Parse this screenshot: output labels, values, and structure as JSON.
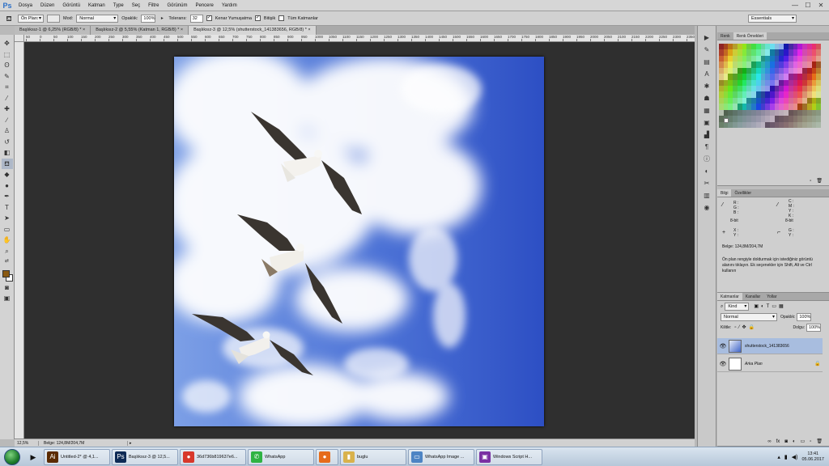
{
  "app": {
    "logo": "Ps"
  },
  "menubar": [
    "Dosya",
    "Düzen",
    "Görüntü",
    "Katman",
    "Type",
    "Seç",
    "Filtre",
    "Görünüm",
    "Pencere",
    "Yardım"
  ],
  "window_controls": {
    "minimize": "—",
    "maximize": "☐",
    "close": "✕"
  },
  "options": {
    "tool_preset": "Ön Plan:",
    "mode_label": "Mod:",
    "mode_value": "Normal",
    "opacity_label": "Opaklık:",
    "opacity_value": "100%",
    "tolerance_label": "Tolerans:",
    "tolerance_value": "32",
    "antialias_label": "Kenar Yumuşatma",
    "contiguous_label": "Bitişik",
    "all_layers_label": "Tüm Katmanlar",
    "workspace": "Essentials"
  },
  "doc_tabs": [
    {
      "label": "Başlıksız-1 @ 6,25% (RGB/8) *",
      "active": false
    },
    {
      "label": "Başlıksız-2 @ 5,55% (Katman 1, RGB/8) *",
      "active": false
    },
    {
      "label": "Başlıksız-3 @ 12,5% (shutterstock_141383656, RGB/8) *",
      "active": true
    }
  ],
  "ruler_labels": [
    "50",
    "0",
    "50",
    "100",
    "150",
    "200",
    "250",
    "300",
    "350",
    "400",
    "450",
    "500",
    "550",
    "600",
    "650",
    "700",
    "750",
    "800",
    "850",
    "900",
    "950",
    "1000",
    "1050",
    "1100",
    "1150",
    "1200",
    "1250",
    "1300",
    "1350",
    "1400",
    "1450",
    "1500",
    "1550",
    "1600",
    "1650",
    "1700",
    "1750",
    "1800",
    "1850",
    "1900",
    "1950",
    "2000",
    "2050",
    "2100",
    "2150",
    "2200",
    "2250",
    "2300",
    "2350"
  ],
  "status": {
    "zoom": "12,5%",
    "doc_size": "Belge: 124,8M/204,7M"
  },
  "swatches_panel": {
    "tab1": "Renk",
    "tab2": "Renk Örnekleri"
  },
  "info_panel": {
    "tab1": "Bilgi",
    "tab2": "Özellikler",
    "r": "R :",
    "g": "G :",
    "b": "B :",
    "c": "C :",
    "m": "M :",
    "y": "Y :",
    "k": "K :",
    "bit_left": "8-bit",
    "bit_right": "8-bit",
    "x": "X :",
    "y2": "Y :",
    "w": "G :",
    "h": "Y :",
    "doc": "Belge: 124,8M/204,7M",
    "hint": "Ön plan rengiyle doldurmak için istediğiniz görüntü alanını tıklayın. Ek seçenekler için Shift, Alt ve Ctrl kullanın"
  },
  "layers_panel": {
    "tab1": "Katmanlar",
    "tab2": "Kanallar",
    "tab3": "Yollar",
    "kind": "Kind",
    "blend": "Normal",
    "opacity_label": "Opaklık:",
    "opacity_value": "100%",
    "lock_label": "Kilitle:",
    "fill_label": "Dolgu:",
    "fill_value": "100%",
    "layers": [
      {
        "name": "shutterstock_141383656",
        "selected": true
      },
      {
        "name": "Arka Plan",
        "selected": false
      }
    ]
  },
  "taskbar": {
    "tasks": [
      {
        "icon": "Ai",
        "label": "Untitled-2* @ 4,1...",
        "color": "#5a2a00"
      },
      {
        "icon": "Ps",
        "label": "Başlıksız-3 @ 12,5...",
        "color": "#0e2a55"
      },
      {
        "icon": "●",
        "label": "36d736b819637e6...",
        "color": "#d8382b"
      },
      {
        "icon": "✆",
        "label": "WhatsApp",
        "color": "#2fb343"
      },
      {
        "icon": "●",
        "label": "",
        "color": "#e66b1a"
      },
      {
        "icon": "▮",
        "label": "buglu",
        "color": "#d9b24c"
      },
      {
        "icon": "▭",
        "label": "WhatsApp Image ...",
        "color": "#4d84c4"
      },
      {
        "icon": "▣",
        "label": "Windows Script H...",
        "color": "#7a2fa3"
      }
    ],
    "time": "13:41",
    "date": "05.06.2017"
  }
}
